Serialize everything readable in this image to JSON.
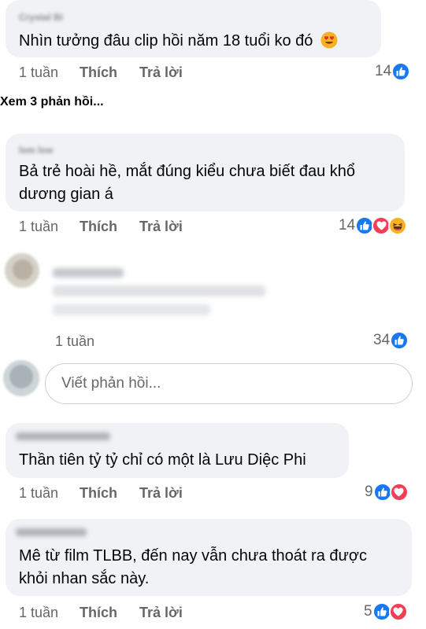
{
  "comments": [
    {
      "author": "Crystal Bi",
      "lines": [
        "Nhìn tưởng đâu clip hồi năm 18 tuổi ko đó"
      ],
      "emoji": "heart-eyes",
      "time": "1 tuần",
      "like_label": "Thích",
      "reply_label": "Trả lời",
      "reaction_count": "14",
      "reactions": [
        "like"
      ]
    },
    {
      "author": "lem lew",
      "lines": [
        "Bả trẻ hoài hề, mắt đúng kiểu chưa biết đau khổ",
        "dương gian á"
      ],
      "time": "1 tuần",
      "like_label": "Thích",
      "reply_label": "Trả lời",
      "reaction_count": "14",
      "reactions": [
        "like",
        "love",
        "haha"
      ]
    },
    {
      "time": "1 tuần",
      "reaction_count": "34",
      "reactions": [
        "like"
      ]
    },
    {
      "lines": [
        "Thần tiên tỷ tỷ chỉ có một là Lưu Diệc Phi"
      ],
      "time": "1 tuần",
      "like_label": "Thích",
      "reply_label": "Trả lời",
      "reaction_count": "9",
      "reactions": [
        "like",
        "love"
      ]
    },
    {
      "lines": [
        "Mê từ film TLBB, đến nay vẫn chưa thoát ra được",
        "khỏi nhan sắc này."
      ],
      "time": "1 tuần",
      "like_label": "Thích",
      "reply_label": "Trả lời",
      "reaction_count": "5",
      "reactions": [
        "like",
        "love"
      ]
    }
  ],
  "view_replies_label": "Xem 3 phản hồi...",
  "reply_input": {
    "placeholder": "Viết phản hồi..."
  },
  "colors": {
    "like": "#1877f2",
    "love": "#f33e58",
    "haha": "#f7b125",
    "bubble": "#f0f2f5",
    "meta": "#65676b"
  }
}
